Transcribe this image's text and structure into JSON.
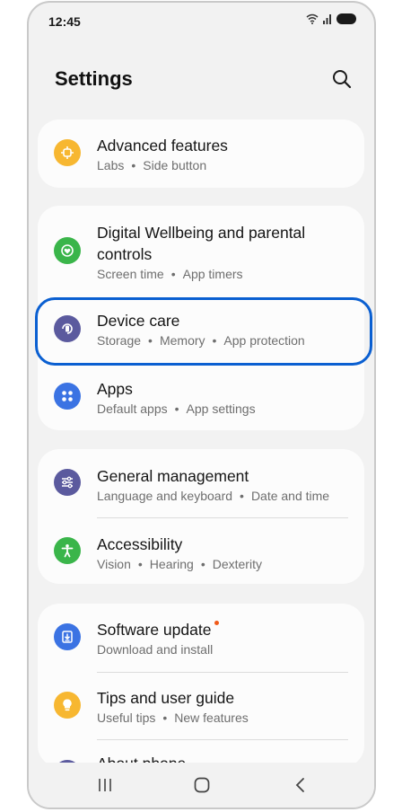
{
  "status": {
    "time": "12:45"
  },
  "header": {
    "title": "Settings"
  },
  "cards": [
    {
      "rows": [
        {
          "title": "Advanced features",
          "sub": [
            "Labs",
            "Side button"
          ],
          "icon": "advanced-features-icon",
          "color": "#f7b731"
        }
      ]
    },
    {
      "rows": [
        {
          "title": "Digital Wellbeing and parental controls",
          "sub": [
            "Screen time",
            "App timers"
          ],
          "icon": "digital-wellbeing-icon",
          "color": "#3ab54a"
        },
        {
          "title": "Device care",
          "sub": [
            "Storage",
            "Memory",
            "App protection"
          ],
          "icon": "device-care-icon",
          "color": "#5b5a9e"
        },
        {
          "title": "Apps",
          "sub": [
            "Default apps",
            "App settings"
          ],
          "icon": "apps-icon",
          "color": "#3b73e3"
        }
      ]
    },
    {
      "rows": [
        {
          "title": "General management",
          "sub": [
            "Language and keyboard",
            "Date and time"
          ],
          "icon": "general-management-icon",
          "color": "#5b5a9e"
        },
        {
          "title": "Accessibility",
          "sub": [
            "Vision",
            "Hearing",
            "Dexterity"
          ],
          "icon": "accessibility-icon",
          "color": "#3ab54a"
        }
      ]
    },
    {
      "rows": [
        {
          "title": "Software update",
          "sub": [
            "Download and install"
          ],
          "icon": "software-update-icon",
          "color": "#3b73e3",
          "badge": true
        },
        {
          "title": "Tips and user guide",
          "sub": [
            "Useful tips",
            "New features"
          ],
          "icon": "tips-icon",
          "color": "#f7b731"
        },
        {
          "title": "About phone",
          "sub": [],
          "icon": "about-phone-icon",
          "color": "#5b5a9e"
        }
      ]
    }
  ],
  "colors": {
    "highlight": "#0a5fd1",
    "background": "#f2f2f2",
    "card": "#fcfcfc"
  }
}
